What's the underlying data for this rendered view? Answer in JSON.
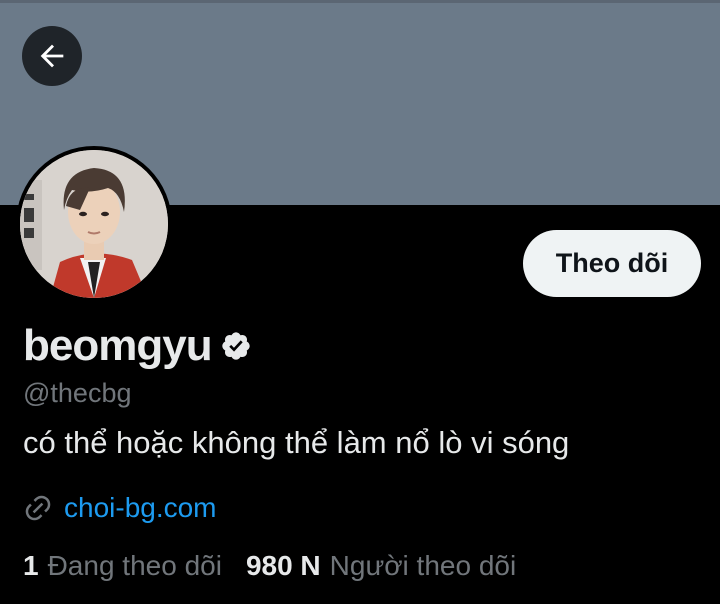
{
  "header": {
    "back_icon": "arrow-left-icon",
    "banner_color": "#6b7a89"
  },
  "profile": {
    "avatar": "profile-photo",
    "follow_label": "Theo dõi",
    "display_name": "beomgyu",
    "verified_icon": "verified-badge-icon",
    "handle": "@thecbg",
    "bio": "có thể hoặc không thể làm nổ lò vi sóng",
    "link_icon": "link-icon",
    "link_text": "choi-bg.com"
  },
  "stats": {
    "following_count": "1",
    "following_label": "Đang theo dõi",
    "followers_count": "980 N",
    "followers_label": "Người theo dõi"
  },
  "colors": {
    "background": "#000000",
    "text_primary": "#e7e9ea",
    "text_secondary": "#71767b",
    "link": "#1d9bf0",
    "button_bg": "#eff3f4"
  }
}
